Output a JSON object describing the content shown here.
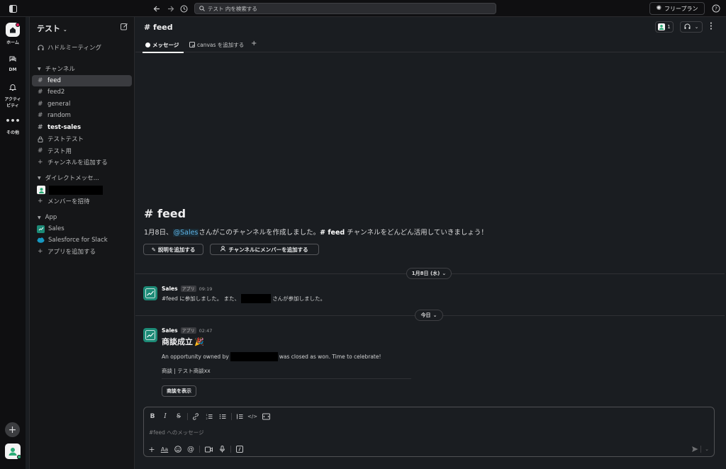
{
  "topbar": {
    "search_placeholder": "テスト 内を検索する",
    "plan_label": "フリープラン"
  },
  "rail": {
    "home": "ホーム",
    "dm": "DM",
    "activity_1": "アクティ",
    "activity_2": "ビティ",
    "more": "その他"
  },
  "sidebar": {
    "workspace": "テスト",
    "huddle": "ハドルミーティング",
    "channels_header": "チャンネル",
    "channels": [
      "feed",
      "feed2",
      "general",
      "random",
      "test-sales",
      "テストテスト",
      "テスト用"
    ],
    "add_channel": "チャンネルを追加する",
    "dm_header": "ダイレクトメッセ...",
    "invite": "メンバーを招待",
    "app_header": "App",
    "apps": [
      "Sales",
      "Salesforce for Slack"
    ],
    "add_app": "アプリを追加する"
  },
  "channel": {
    "name": "feed",
    "tab_messages": "メッセージ",
    "tab_canvas": "canvas を追加する",
    "member_count": "1"
  },
  "intro": {
    "title": "feed",
    "text_before": "1月8日、",
    "mention": "@Sales",
    "text_mid": "さんがこのチャンネルを作成しました。",
    "text_channel": "feed",
    "text_after": "チャンネルをどんどん活用していきましょう！",
    "btn_description": "説明を追加する",
    "btn_add_members": "チャンネルにメンバーを追加する"
  },
  "dates": {
    "first": "1月8日 (水)",
    "today": "今日"
  },
  "messages": [
    {
      "author": "Sales",
      "badge": "アプリ",
      "time": "09:19",
      "text_before": "#feed に参加しました。 また、",
      "text_after": "さんが参加しました。"
    },
    {
      "author": "Sales",
      "badge": "アプリ",
      "time": "02:47",
      "heading": "商談成立",
      "heading_emoji": "🎉",
      "text_before": "An opportunity owned by",
      "text_after": "was closed as won. Time to celebrate!",
      "detail": "商談 | テスト商談xx",
      "button": "商談を表示"
    }
  ],
  "composer": {
    "placeholder": "#feed へのメッセージ",
    "aa": "Aa"
  },
  "colors": {
    "accent_green": "#2bac76",
    "mention_blue": "#5fb3e6",
    "app_teal": "#1c8a76"
  }
}
